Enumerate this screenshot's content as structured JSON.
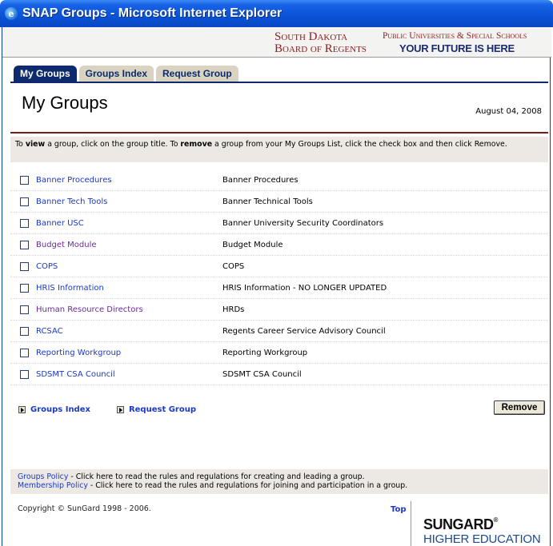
{
  "window": {
    "title": "SNAP Groups - Microsoft Internet Explorer",
    "icon": "ie-icon"
  },
  "header": {
    "sdbor_line1": "South Dakota",
    "sdbor_line2": "Board of Regents",
    "puss": "Public Universities & Special Schools",
    "tagline": "YOUR FUTURE IS HERE"
  },
  "tabs": [
    {
      "label": "My Groups",
      "active": true
    },
    {
      "label": "Groups Index",
      "active": false
    },
    {
      "label": "Request Group",
      "active": false
    }
  ],
  "page": {
    "title": "My Groups",
    "date": "August 04, 2008"
  },
  "instructions": {
    "p1": "To ",
    "view": "view",
    "p2": " a group, click on the group title. To ",
    "remove": "remove",
    "p3": " a group from your My Groups List, click the check box and then click Remove."
  },
  "groups": [
    {
      "name": "Banner Procedures",
      "desc": "Banner Procedures"
    },
    {
      "name": "Banner Tech Tools",
      "desc": "Banner Technical Tools"
    },
    {
      "name": "Banner USC",
      "desc": "Banner University Security Coordinators"
    },
    {
      "name": "Budget Module",
      "desc": "Budget Module"
    },
    {
      "name": "COPS",
      "desc": "COPS"
    },
    {
      "name": "HRIS Information",
      "desc": "HRIS Information - NO LONGER UPDATED"
    },
    {
      "name": "Human Resource Directors",
      "desc": "HRDs"
    },
    {
      "name": "RCSAC",
      "desc": "Regents Career Service Advisory Council"
    },
    {
      "name": "Reporting Workgroup",
      "desc": "Reporting Workgroup"
    },
    {
      "name": "SDSMT CSA Council",
      "desc": "SDSMT CSA Council"
    }
  ],
  "links": {
    "groups_index": "Groups Index",
    "request_group": "Request Group"
  },
  "buttons": {
    "remove": "Remove"
  },
  "policies": {
    "groups_policy": "Groups Policy",
    "groups_policy_text": " - Click here to read the rules and regulations for creating and leading a group.",
    "membership_policy": "Membership Policy",
    "membership_policy_text": " - Click here to read the rules and regulations for joining and participation in a group."
  },
  "footer": {
    "copyright": "Copyright © SunGard 1998 - 2006.",
    "top": "Top",
    "logo_line1": "SUNGARD",
    "logo_reg": "®",
    "logo_line2": "HIGHER EDUCATION"
  },
  "colors": {
    "tab_active": "#0d2a6e",
    "tab_inactive": "#d9d3c0",
    "link": "#1a38c8",
    "rule": "#7a1a1a",
    "titlebar": "#0a52d6"
  }
}
